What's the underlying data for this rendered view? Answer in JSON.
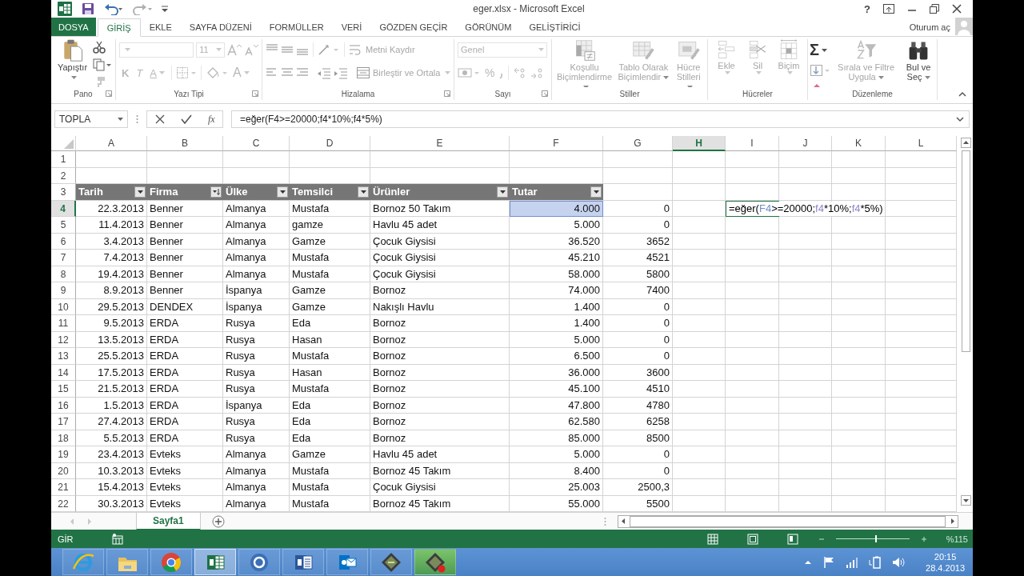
{
  "window": {
    "title": "eger.xlsx - Microsoft Excel",
    "help": "?"
  },
  "tabs": [
    {
      "label": "DOSYA",
      "kind": "file",
      "selected": false
    },
    {
      "label": "GİRİŞ",
      "kind": "tab",
      "selected": true
    },
    {
      "label": "EKLE",
      "kind": "tab",
      "selected": false
    },
    {
      "label": "SAYFA DÜZENİ",
      "kind": "tab",
      "selected": false
    },
    {
      "label": "FORMÜLLER",
      "kind": "tab",
      "selected": false
    },
    {
      "label": "VERİ",
      "kind": "tab",
      "selected": false
    },
    {
      "label": "GÖZDEN GEÇİR",
      "kind": "tab",
      "selected": false
    },
    {
      "label": "GÖRÜNÜM",
      "kind": "tab",
      "selected": false
    },
    {
      "label": "GELİŞTİRİCİ",
      "kind": "tab",
      "selected": false
    }
  ],
  "account": {
    "label": "Oturum aç"
  },
  "ribbon": {
    "clipboard": {
      "label": "Pano",
      "paste": {
        "label": "Yapıştır",
        "disabled": false
      }
    },
    "font": {
      "label": "Yazı Tipi",
      "size": {
        "value": "11",
        "disabled": true
      },
      "bold": {
        "label": "K",
        "disabled": true
      },
      "italic": {
        "label": "T",
        "disabled": true
      },
      "underline": {
        "label": "A",
        "disabled": true
      },
      "font_color": {
        "label": "A",
        "disabled": true
      }
    },
    "alignment": {
      "label": "Hizalama",
      "wrap_text": {
        "label": "Metni Kaydır",
        "disabled": true
      },
      "merge": {
        "label": "Birleştir ve Ortala",
        "disabled": true
      }
    },
    "number": {
      "label": "Sayı",
      "format": {
        "value": "Genel",
        "disabled": true
      },
      "percent": {
        "label": "%",
        "disabled": true
      }
    },
    "styles": {
      "label": "Stiller",
      "commands": [
        {
          "label": "Koşullu Biçimlendirme",
          "disabled": true
        },
        {
          "label": "Tablo Olarak Biçimlendir",
          "disabled": true
        },
        {
          "label": "Hücre Stilleri",
          "disabled": true
        }
      ]
    },
    "cells": {
      "label": "Hücreler",
      "commands": [
        {
          "label": "Ekle",
          "disabled": true
        },
        {
          "label": "Sil",
          "disabled": true
        },
        {
          "label": "Biçim",
          "disabled": true
        }
      ]
    },
    "editing": {
      "label": "Düzenleme",
      "autosum": {
        "label": "Σ",
        "disabled": false
      },
      "commands": [
        {
          "label": "Sırala ve Filtre Uygula",
          "disabled": true
        },
        {
          "label": "Bul ve Seç",
          "disabled": false
        }
      ]
    }
  },
  "name_box": {
    "value": "TOPLA"
  },
  "formula_bar": {
    "function_label": "fx",
    "value": "=eğer(F4>=20000;f4*10%;f4*5%)"
  },
  "columns": [
    {
      "label": "A",
      "selected": false
    },
    {
      "label": "B",
      "selected": false
    },
    {
      "label": "C",
      "selected": false
    },
    {
      "label": "D",
      "selected": false
    },
    {
      "label": "E",
      "selected": false
    },
    {
      "label": "F",
      "selected": false
    },
    {
      "label": "G",
      "selected": false
    },
    {
      "label": "H",
      "selected": true
    },
    {
      "label": "I",
      "selected": false
    },
    {
      "label": "J",
      "selected": false
    },
    {
      "label": "K",
      "selected": false
    },
    {
      "label": "L",
      "selected": false
    }
  ],
  "rows": [
    {
      "number": "1",
      "kind": "empty",
      "selected": false
    },
    {
      "number": "2",
      "kind": "empty",
      "selected": false
    },
    {
      "number": "3",
      "kind": "header",
      "selected": false,
      "cells": [
        {
          "text": "Tarih",
          "kind": "filter"
        },
        {
          "text": "Firma",
          "kind": "sorted"
        },
        {
          "text": "Ülke",
          "kind": "filter"
        },
        {
          "text": "Temsilci",
          "kind": "filter"
        },
        {
          "text": "Ürünler",
          "kind": "filter"
        },
        {
          "text": "Tutar",
          "kind": "filter"
        }
      ]
    },
    {
      "number": "4",
      "kind": "data",
      "selected": true,
      "cells": [
        {
          "text": "22.3.2013",
          "highlighted": false
        },
        {
          "text": "Benner",
          "highlighted": false
        },
        {
          "text": "Almanya",
          "highlighted": false
        },
        {
          "text": "Mustafa",
          "highlighted": false
        },
        {
          "text": "Bornoz 50 Takım",
          "highlighted": false
        },
        {
          "text": "4.000",
          "highlighted": true
        },
        {
          "text": "0",
          "highlighted": false
        }
      ],
      "editor": {
        "parts": [
          {
            "text": "=eğer(",
            "color": "#000000"
          },
          {
            "text": "F4",
            "color": "#6f8fcf"
          },
          {
            "text": ">=20000;",
            "color": "#000000"
          },
          {
            "text": "f4",
            "color": "#8c86c9"
          },
          {
            "text": "*10%;",
            "color": "#000000"
          },
          {
            "text": "f4",
            "color": "#8c86c9"
          },
          {
            "text": "*5%)",
            "color": "#000000"
          }
        ]
      }
    },
    {
      "number": "5",
      "kind": "data",
      "selected": false,
      "cells": [
        "11.4.2013",
        "Benner",
        "Almanya",
        "gamze",
        "Havlu 45 adet",
        "5.000",
        "0"
      ]
    },
    {
      "number": "6",
      "kind": "data",
      "selected": false,
      "cells": [
        "3.4.2013",
        "Benner",
        "Almanya",
        "Gamze",
        "Çocuk Giysisi",
        "36.520",
        "3652"
      ]
    },
    {
      "number": "7",
      "kind": "data",
      "selected": false,
      "cells": [
        "7.4.2013",
        "Benner",
        "Almanya",
        "Mustafa",
        "Çocuk Giysisi",
        "45.210",
        "4521"
      ]
    },
    {
      "number": "8",
      "kind": "data",
      "selected": false,
      "cells": [
        "19.4.2013",
        "Benner",
        "Almanya",
        "Mustafa",
        "Çocuk Giysisi",
        "58.000",
        "5800"
      ]
    },
    {
      "number": "9",
      "kind": "data",
      "selected": false,
      "cells": [
        "8.9.2013",
        "Benner",
        "İspanya",
        "Gamze",
        "Bornoz",
        "74.000",
        "7400"
      ]
    },
    {
      "number": "10",
      "kind": "data",
      "selected": false,
      "cells": [
        "29.5.2013",
        "DENDEX",
        "İspanya",
        "Gamze",
        "Nakışlı Havlu",
        "1.400",
        "0"
      ]
    },
    {
      "number": "11",
      "kind": "data",
      "selected": false,
      "cells": [
        "9.5.2013",
        "ERDA",
        "Rusya",
        "Eda",
        "Bornoz",
        "1.400",
        "0"
      ]
    },
    {
      "number": "12",
      "kind": "data",
      "selected": false,
      "cells": [
        "13.5.2013",
        "ERDA",
        "Rusya",
        "Hasan",
        "Bornoz",
        "5.000",
        "0"
      ]
    },
    {
      "number": "13",
      "kind": "data",
      "selected": false,
      "cells": [
        "25.5.2013",
        "ERDA",
        "Rusya",
        "Mustafa",
        "Bornoz",
        "6.500",
        "0"
      ]
    },
    {
      "number": "14",
      "kind": "data",
      "selected": false,
      "cells": [
        "17.5.2013",
        "ERDA",
        "Rusya",
        "Hasan",
        "Bornoz",
        "36.000",
        "3600"
      ]
    },
    {
      "number": "15",
      "kind": "data",
      "selected": false,
      "cells": [
        "21.5.2013",
        "ERDA",
        "Rusya",
        "Mustafa",
        "Bornoz",
        "45.100",
        "4510"
      ]
    },
    {
      "number": "16",
      "kind": "data",
      "selected": false,
      "cells": [
        "1.5.2013",
        "ERDA",
        "İspanya",
        "Eda",
        "Bornoz",
        "47.800",
        "4780"
      ]
    },
    {
      "number": "17",
      "kind": "data",
      "selected": false,
      "cells": [
        "27.4.2013",
        "ERDA",
        "Rusya",
        "Eda",
        "Bornoz",
        "62.580",
        "6258"
      ]
    },
    {
      "number": "18",
      "kind": "data",
      "selected": false,
      "cells": [
        "5.5.2013",
        "ERDA",
        "Rusya",
        "Eda",
        "Bornoz",
        "85.000",
        "8500"
      ]
    },
    {
      "number": "19",
      "kind": "data",
      "selected": false,
      "cells": [
        "23.4.2013",
        "Evteks",
        "Almanya",
        "Gamze",
        "Havlu 45 adet",
        "5.000",
        "0"
      ]
    },
    {
      "number": "20",
      "kind": "data",
      "selected": false,
      "cells": [
        "10.3.2013",
        "Evteks",
        "Almanya",
        "Mustafa",
        "Bornoz 45 Takım",
        "8.400",
        "0"
      ]
    },
    {
      "number": "21",
      "kind": "data",
      "selected": false,
      "cells": [
        "15.4.2013",
        "Evteks",
        "Almanya",
        "Mustafa",
        "Çocuk Giysisi",
        "25.003",
        "2500,3"
      ]
    },
    {
      "number": "22",
      "kind": "data",
      "selected": false,
      "cells": [
        "30.3.2013",
        "Evteks",
        "Almanya",
        "Mustafa",
        "Bornoz 45 Takım",
        "55.000",
        "5500"
      ]
    }
  ],
  "sheet_tabs": [
    {
      "label": "Sayfa1",
      "selected": true
    }
  ],
  "status_bar": {
    "mode": "GİR",
    "zoom": {
      "label": "%115",
      "level": 0.55
    }
  },
  "taskbar": {
    "apps": [
      {
        "selected": false
      },
      {
        "selected": false
      },
      {
        "selected": false
      },
      {
        "selected": true
      },
      {
        "selected": false
      },
      {
        "selected": false
      },
      {
        "selected": false
      },
      {
        "selected": false
      },
      {
        "selected": false
      }
    ],
    "clock": {
      "time": "20:15",
      "date": "28.4.2013"
    }
  }
}
